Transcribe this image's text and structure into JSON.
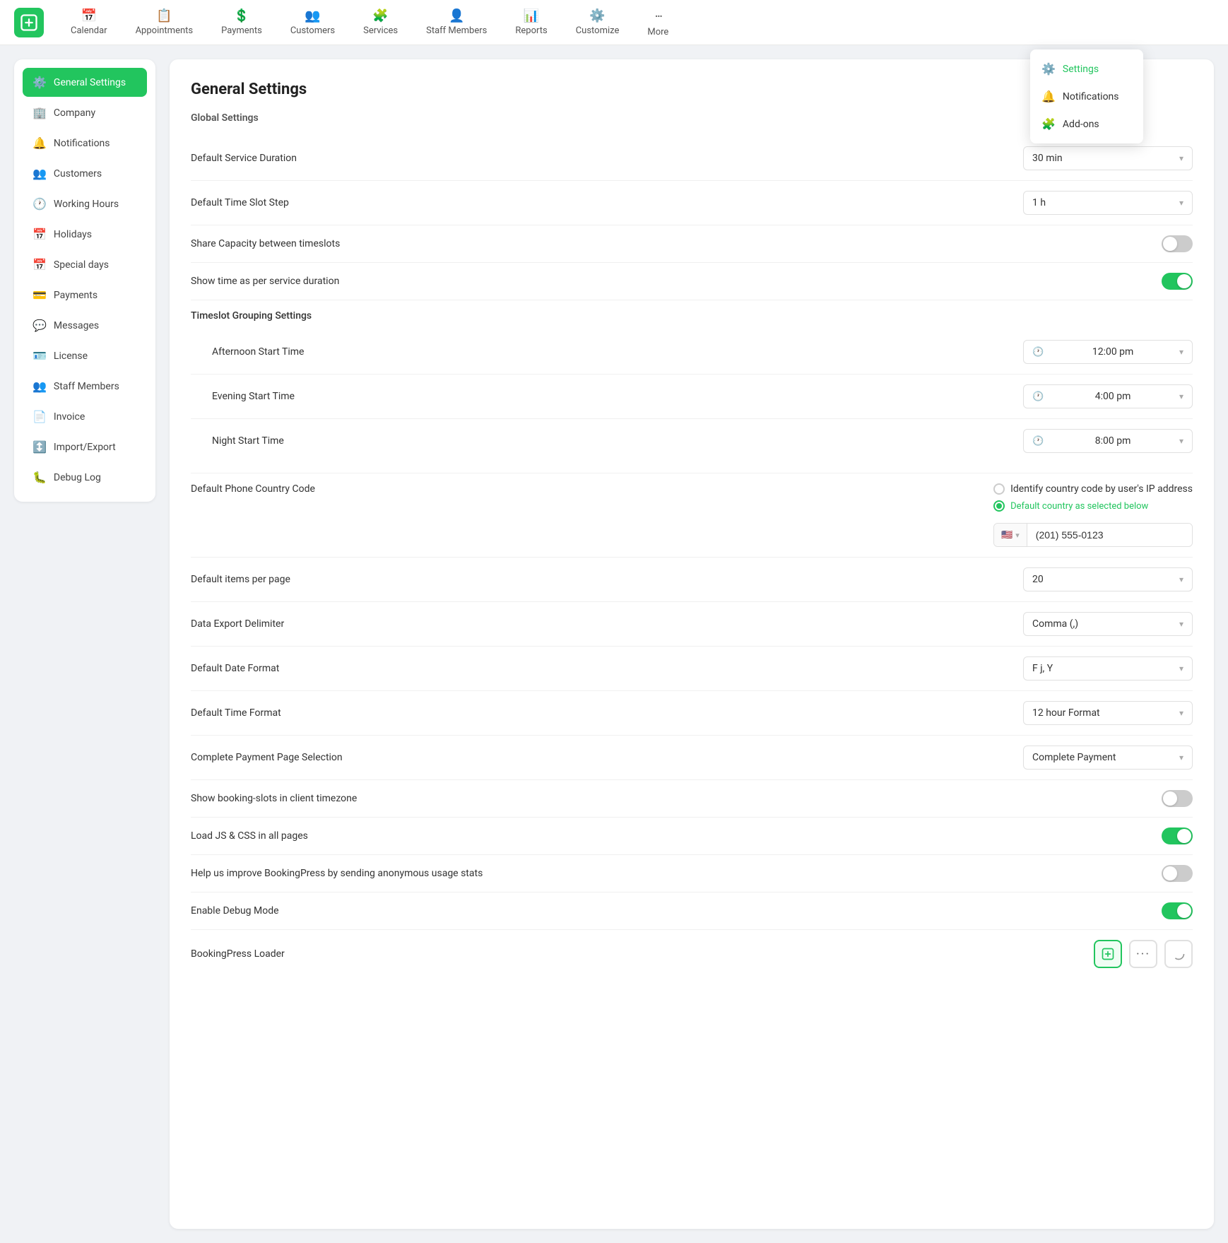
{
  "nav": {
    "items": [
      {
        "id": "calendar",
        "label": "Calendar",
        "icon": "📅"
      },
      {
        "id": "appointments",
        "label": "Appointments",
        "icon": "📋"
      },
      {
        "id": "payments",
        "label": "Payments",
        "icon": "💲"
      },
      {
        "id": "customers",
        "label": "Customers",
        "icon": "👥"
      },
      {
        "id": "services",
        "label": "Services",
        "icon": "🧩"
      },
      {
        "id": "staff-members",
        "label": "Staff Members",
        "icon": "👤"
      },
      {
        "id": "reports",
        "label": "Reports",
        "icon": "📊"
      },
      {
        "id": "customize",
        "label": "Customize",
        "icon": "⚙️"
      },
      {
        "id": "more",
        "label": "More",
        "icon": "···"
      }
    ]
  },
  "dropdown": {
    "items": [
      {
        "id": "settings",
        "label": "Settings",
        "icon": "⚙️",
        "active": true
      },
      {
        "id": "notifications",
        "label": "Notifications",
        "icon": "🔔",
        "active": false
      },
      {
        "id": "add-ons",
        "label": "Add-ons",
        "icon": "🧩",
        "active": false
      }
    ]
  },
  "sidebar": {
    "items": [
      {
        "id": "general-settings",
        "label": "General Settings",
        "icon": "⚙️",
        "active": true
      },
      {
        "id": "company",
        "label": "Company",
        "icon": "🏢",
        "active": false
      },
      {
        "id": "notifications",
        "label": "Notifications",
        "icon": "🔔",
        "active": false
      },
      {
        "id": "customers",
        "label": "Customers",
        "icon": "👥",
        "active": false
      },
      {
        "id": "working-hours",
        "label": "Working Hours",
        "icon": "🕐",
        "active": false
      },
      {
        "id": "holidays",
        "label": "Holidays",
        "icon": "📅",
        "active": false
      },
      {
        "id": "special-days",
        "label": "Special days",
        "icon": "📅",
        "active": false
      },
      {
        "id": "payments",
        "label": "Payments",
        "icon": "💳",
        "active": false
      },
      {
        "id": "messages",
        "label": "Messages",
        "icon": "💬",
        "active": false
      },
      {
        "id": "license",
        "label": "License",
        "icon": "🪪",
        "active": false
      },
      {
        "id": "staff-members",
        "label": "Staff Members",
        "icon": "👥",
        "active": false
      },
      {
        "id": "invoice",
        "label": "Invoice",
        "icon": "📄",
        "active": false
      },
      {
        "id": "import-export",
        "label": "Import/Export",
        "icon": "↕️",
        "active": false
      },
      {
        "id": "debug-log",
        "label": "Debug Log",
        "icon": "🐛",
        "active": false
      }
    ]
  },
  "page": {
    "title": "General Settings",
    "section_title": "Global Settings"
  },
  "settings": {
    "default_service_duration": {
      "label": "Default Service Duration",
      "value": "30 min"
    },
    "default_time_slot_step": {
      "label": "Default Time Slot Step",
      "value": "1 h"
    },
    "share_capacity": {
      "label": "Share Capacity between timeslots",
      "enabled": false
    },
    "show_time_as_service": {
      "label": "Show time as per service duration",
      "enabled": true
    },
    "timeslot_grouping": {
      "title": "Timeslot Grouping Settings",
      "afternoon_start": {
        "label": "Afternoon Start Time",
        "value": "12:00 pm"
      },
      "evening_start": {
        "label": "Evening Start Time",
        "value": "4:00 pm"
      },
      "night_start": {
        "label": "Night Start Time",
        "value": "8:00 pm"
      }
    },
    "default_phone_country": {
      "label": "Default Phone Country Code",
      "radio_ip": "Identify country code by user's IP address",
      "radio_default": "Default country as selected below",
      "phone_flag": "🇺🇸",
      "phone_number": "(201) 555-0123"
    },
    "default_items_per_page": {
      "label": "Default items per page",
      "value": "20"
    },
    "data_export_delimiter": {
      "label": "Data Export Delimiter",
      "value": "Comma (,)"
    },
    "default_date_format": {
      "label": "Default Date Format",
      "value": "F j, Y"
    },
    "default_time_format": {
      "label": "Default Time Format",
      "value": "12 hour Format"
    },
    "complete_payment": {
      "label": "Complete Payment Page Selection",
      "value": "Complete Payment"
    },
    "show_booking_slots_timezone": {
      "label": "Show booking-slots in client timezone",
      "enabled": false
    },
    "load_js_css": {
      "label": "Load JS & CSS in all pages",
      "enabled": true
    },
    "anonymous_usage": {
      "label": "Help us improve BookingPress by sending anonymous usage stats",
      "enabled": false
    },
    "enable_debug": {
      "label": "Enable Debug Mode",
      "enabled": true
    },
    "bookingpress_loader": {
      "label": "BookingPress Loader"
    }
  }
}
